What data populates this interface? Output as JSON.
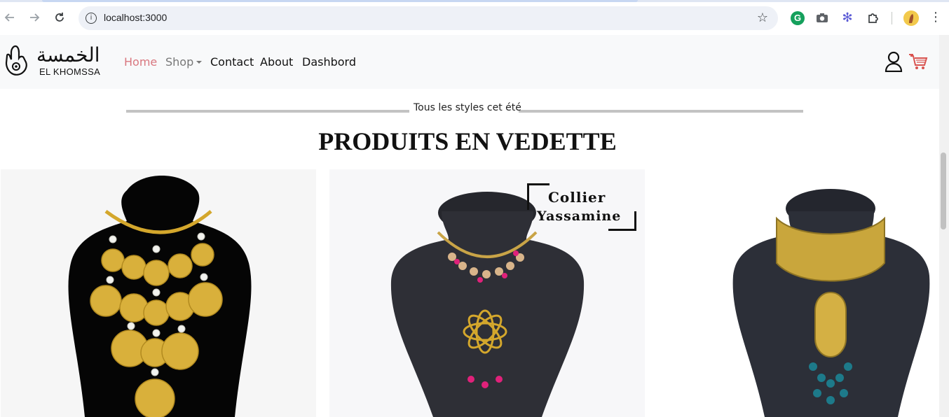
{
  "browser": {
    "url": "localhost:3000",
    "icons": [
      "back-icon",
      "forward-icon",
      "reload-icon",
      "site-info-icon",
      "bookmark-star-icon",
      "grammarly-icon",
      "camera-icon",
      "extension-flower-icon",
      "extensions-puzzle-icon",
      "profile-avatar",
      "more-menu-icon"
    ]
  },
  "header": {
    "logo_arabic": "الخمسة",
    "logo_text": "EL KHOMSSA",
    "nav": {
      "home": "Home",
      "shop": "Shop",
      "contact": "Contact",
      "about": "About",
      "dashboard": "Dashbord"
    },
    "colors": {
      "active_link": "#d9777f",
      "muted_link": "#777777",
      "cart": "#d9534f"
    }
  },
  "featured": {
    "subtitle": "Tous les styles cet été",
    "title": "PRODUITS EN VEDETTE",
    "products": [
      {
        "image": "gold-coin-necklace"
      },
      {
        "image": "collier-yassamine-necklace",
        "overlay_line1": "Collier",
        "overlay_line2": "Yassamine"
      },
      {
        "image": "khomssa-collar-necklace"
      }
    ]
  }
}
